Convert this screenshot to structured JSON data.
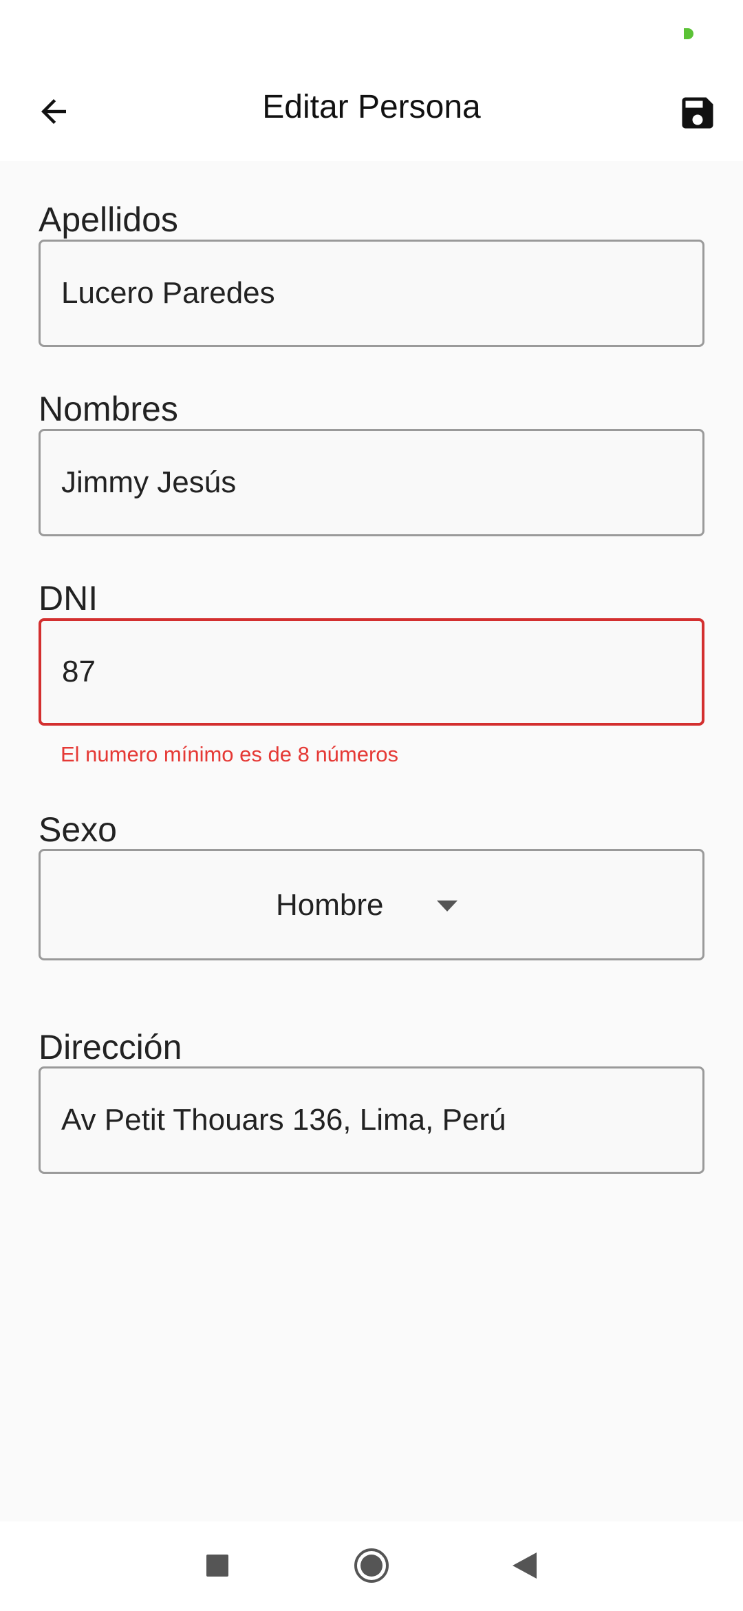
{
  "app_bar": {
    "title": "Editar Persona",
    "back_icon": "arrow-left-icon",
    "save_icon": "floppy-disk-icon"
  },
  "form": {
    "apellidos": {
      "label": "Apellidos",
      "value": "Lucero Paredes"
    },
    "nombres": {
      "label": "Nombres",
      "value": "Jimmy Jesús"
    },
    "dni": {
      "label": "DNI",
      "value": "87",
      "error": "El numero mínimo es de 8 números"
    },
    "sexo": {
      "label": "Sexo",
      "value": "Hombre"
    },
    "direccion": {
      "label": "Dirección",
      "value": "Av Petit Thouars 136, Lima, Perú"
    }
  },
  "colors": {
    "error": "#d32f2f",
    "status_dot": "#5bc236",
    "background": "#fafafa"
  },
  "nav_icons": [
    "recents-square-icon",
    "home-circle-icon",
    "back-triangle-icon"
  ]
}
